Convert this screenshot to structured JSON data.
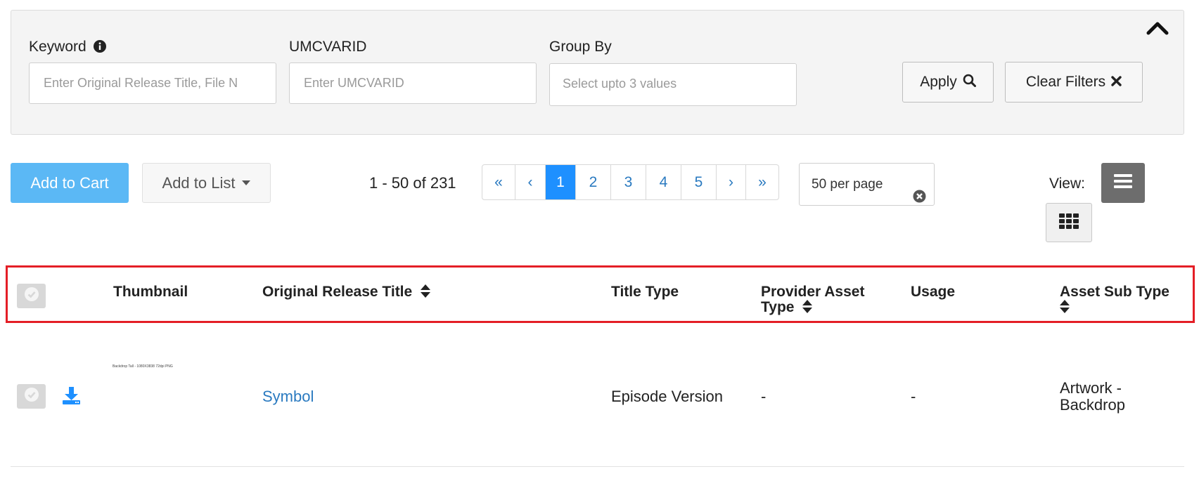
{
  "filters": {
    "keyword_label": "Keyword",
    "keyword_placeholder": "Enter Original Release Title, File N",
    "umcvarid_label": "UMCVARID",
    "umcvarid_placeholder": "Enter UMCVARID",
    "groupby_label": "Group By",
    "groupby_placeholder": "Select upto 3 values",
    "apply_label": "Apply",
    "clear_label": "Clear Filters"
  },
  "toolbar": {
    "add_to_cart": "Add to Cart",
    "add_to_list": "Add to List",
    "count_text": "1 - 50 of 231",
    "pages": [
      "1",
      "2",
      "3",
      "4",
      "5"
    ],
    "first": "«",
    "prev": "‹",
    "next": "›",
    "last": "»",
    "current_page": "1",
    "per_page": "50 per page",
    "view_label": "View:"
  },
  "table": {
    "headers": {
      "thumbnail": "Thumbnail",
      "original_release_title": "Original Release Title",
      "title_type": "Title Type",
      "provider_asset_type_1": "Provider Asset",
      "provider_asset_type_2": "Type",
      "usage": "Usage",
      "asset_sub_type": "Asset Sub Type"
    },
    "rows": [
      {
        "thumbnail_text": "Backdrop Tall - 1080X3838 72dpi PNG",
        "title": "Symbol",
        "title_type": "Episode Version",
        "provider_asset_type": "-",
        "usage": "-",
        "asset_sub_type_1": "Artwork -",
        "asset_sub_type_2": "Backdrop"
      }
    ]
  },
  "colors": {
    "primary": "#1e90ff",
    "cart_button": "#5bb8f5",
    "highlight": "#e41e26",
    "link": "#2a7ac0"
  },
  "icons": [
    "info-icon",
    "chevron-up-icon",
    "search-icon",
    "close-icon",
    "caret-down-icon",
    "clear-circle-icon",
    "list-view-icon",
    "grid-view-icon",
    "check-icon",
    "sort-icon",
    "download-icon"
  ]
}
